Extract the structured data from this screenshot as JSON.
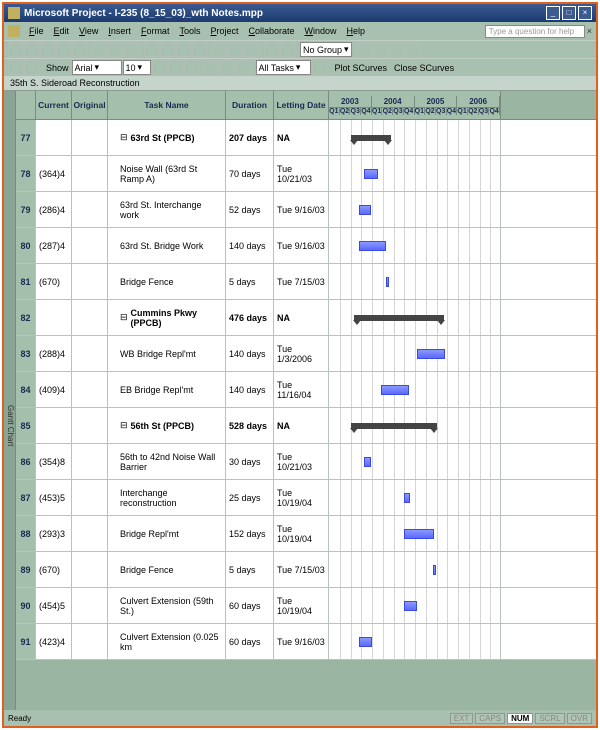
{
  "window": {
    "title": "Microsoft Project - I-235 (8_15_03)_wth Notes.mpp"
  },
  "menu": [
    "File",
    "Edit",
    "View",
    "Insert",
    "Format",
    "Tools",
    "Project",
    "Collaborate",
    "Window",
    "Help"
  ],
  "help": {
    "placeholder": "Type a question for help"
  },
  "toolbar": {
    "showLabel": "Show",
    "font": "Arial",
    "size": "10",
    "filter": "All Tasks",
    "group": "No Group",
    "plotBtn": "Plot SCurves",
    "closeBtn": "Close SCurves"
  },
  "subhead": "35th S. Sideroad Reconstruction",
  "sidetab": "Gantt Chart",
  "columns": {
    "current": "Current",
    "original": "Original",
    "taskname": "Task Name",
    "duration": "Duration",
    "letting": "Letting Date"
  },
  "timeline": {
    "years": [
      "2003",
      "2004",
      "2005",
      "2006"
    ],
    "quarters": [
      "Q1",
      "Q2",
      "Q3",
      "Q4"
    ]
  },
  "rows": [
    {
      "n": "77",
      "cur": "",
      "org": "",
      "task": "63rd St (PPCB)",
      "dur": "207 days",
      "let": "NA",
      "summary": true,
      "g": {
        "type": "sum",
        "l": 22,
        "w": 40
      }
    },
    {
      "n": "78",
      "cur": "(364)4",
      "org": "",
      "task": "Noise Wall (63rd St Ramp A)",
      "dur": "70 days",
      "let": "Tue 10/21/03",
      "g": {
        "type": "bar",
        "l": 35,
        "w": 14
      }
    },
    {
      "n": "79",
      "cur": "(286)4",
      "org": "",
      "task": "63rd St. Interchange work",
      "dur": "52 days",
      "let": "Tue 9/16/03",
      "g": {
        "type": "bar",
        "l": 30,
        "w": 12
      }
    },
    {
      "n": "80",
      "cur": "(287)4",
      "org": "",
      "task": "63rd St. Bridge Work",
      "dur": "140 days",
      "let": "Tue 9/16/03",
      "g": {
        "type": "bar",
        "l": 30,
        "w": 27
      }
    },
    {
      "n": "81",
      "cur": "(670)",
      "org": "",
      "task": "Bridge Fence",
      "dur": "5 days",
      "let": "Tue 7/15/03",
      "g": {
        "type": "bar",
        "l": 57,
        "w": 3
      }
    },
    {
      "n": "82",
      "cur": "",
      "org": "",
      "task": "Cummins Pkwy (PPCB)",
      "dur": "476 days",
      "let": "NA",
      "summary": true,
      "g": {
        "type": "sum",
        "l": 25,
        "w": 90
      }
    },
    {
      "n": "83",
      "cur": "(288)4",
      "org": "",
      "task": "WB Bridge Repl'mt",
      "dur": "140 days",
      "let": "Tue 1/3/2006",
      "g": {
        "type": "bar",
        "l": 88,
        "w": 28
      }
    },
    {
      "n": "84",
      "cur": "(409)4",
      "org": "",
      "task": "EB Bridge Repl'mt",
      "dur": "140 days",
      "let": "Tue 11/16/04",
      "g": {
        "type": "bar",
        "l": 52,
        "w": 28
      }
    },
    {
      "n": "85",
      "cur": "",
      "org": "",
      "task": "56th St (PPCB)",
      "dur": "528 days",
      "let": "NA",
      "summary": true,
      "g": {
        "type": "sum",
        "l": 22,
        "w": 86
      }
    },
    {
      "n": "86",
      "cur": "(354)8",
      "org": "",
      "task": "56th to 42nd Noise Wall Barrier",
      "dur": "30 days",
      "let": "Tue 10/21/03",
      "g": {
        "type": "bar",
        "l": 35,
        "w": 7
      }
    },
    {
      "n": "87",
      "cur": "(453)5",
      "org": "",
      "task": "Interchange reconstruction",
      "dur": "25 days",
      "let": "Tue 10/19/04",
      "g": {
        "type": "bar",
        "l": 75,
        "w": 6
      }
    },
    {
      "n": "88",
      "cur": "(293)3",
      "org": "",
      "task": "Bridge Repl'mt",
      "dur": "152 days",
      "let": "Tue 10/19/04",
      "g": {
        "type": "bar",
        "l": 75,
        "w": 30
      }
    },
    {
      "n": "89",
      "cur": "(670)",
      "org": "",
      "task": "Bridge Fence",
      "dur": "5 days",
      "let": "Tue 7/15/03",
      "g": {
        "type": "bar",
        "l": 104,
        "w": 3
      }
    },
    {
      "n": "90",
      "cur": "(454)5",
      "org": "",
      "task": "Culvert Extension (59th St.)",
      "dur": "60 days",
      "let": "Tue 10/19/04",
      "g": {
        "type": "bar",
        "l": 75,
        "w": 13
      }
    },
    {
      "n": "91",
      "cur": "(423)4",
      "org": "",
      "task": "Culvert Extension (0.025 km",
      "dur": "60 days",
      "let": "Tue 9/16/03",
      "g": {
        "type": "bar",
        "l": 30,
        "w": 13
      }
    }
  ],
  "footer": {
    "ready": "Ready",
    "caps": "CAPS",
    "num": "NUM",
    "ext": "EXT",
    "scrl": "SCRL",
    "ovr": "OVR"
  }
}
